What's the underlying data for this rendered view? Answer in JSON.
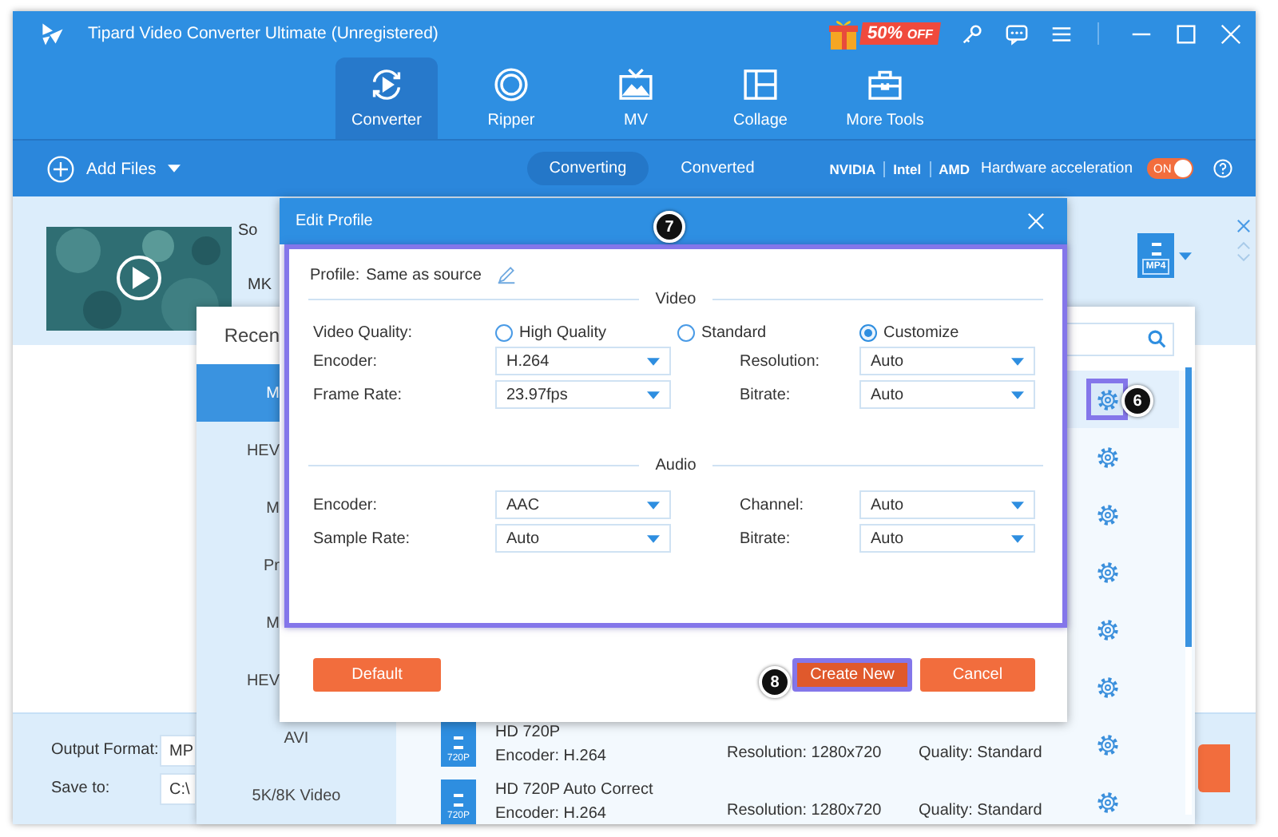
{
  "window": {
    "title": "Tipard Video Converter Ultimate (Unregistered)",
    "promo": {
      "percent": "50%",
      "suffix": "OFF"
    }
  },
  "nav_tabs": [
    {
      "label": "Converter",
      "selected": true,
      "kind": "converter"
    },
    {
      "label": "Ripper",
      "selected": false,
      "kind": "ripper"
    },
    {
      "label": "MV",
      "selected": false,
      "kind": "mv"
    },
    {
      "label": "Collage",
      "selected": false,
      "kind": "collage"
    },
    {
      "label": "More Tools",
      "selected": false,
      "kind": "tools"
    }
  ],
  "toolbar": {
    "add_files": "Add Files",
    "subtabs": [
      {
        "label": "Converting",
        "selected": true
      },
      {
        "label": "Converted",
        "selected": false
      }
    ],
    "vendors": [
      "NVIDIA",
      "Intel",
      "AMD"
    ],
    "hardware_label": "Hardware acceleration",
    "toggle": {
      "label": "ON",
      "on": true
    }
  },
  "file_item": {
    "source_label": "So",
    "format_label": "MK",
    "target_format": "MP4"
  },
  "output": {
    "format_label": "Output Format:",
    "format_value": "MP",
    "save_label": "Save to:",
    "save_value": "C:\\"
  },
  "format_panel": {
    "heading": "Recen",
    "categories": [
      {
        "label": "M",
        "selected": true
      },
      {
        "label": "HEV",
        "selected": false
      },
      {
        "label": "M",
        "selected": false
      },
      {
        "label": "Pr",
        "selected": false
      },
      {
        "label": "M",
        "selected": false
      },
      {
        "label": "HEV",
        "selected": false
      },
      {
        "label": "AVI",
        "selected": false
      },
      {
        "label": "5K/8K Video",
        "selected": false
      }
    ],
    "rows": [
      {
        "highlighted": true
      },
      {
        "highlighted": false
      },
      {
        "highlighted": false
      },
      {
        "highlighted": false
      },
      {
        "highlighted": false
      },
      {
        "highlighted": false
      },
      {
        "highlighted": false,
        "badge": "720P",
        "name": "HD 720P",
        "encoder": "Encoder: H.264",
        "resolution": "Resolution: 1280x720",
        "quality": "Quality: Standard"
      },
      {
        "highlighted": false,
        "badge": "720P",
        "name": "HD 720P Auto Correct",
        "encoder": "Encoder: H.264",
        "resolution": "Resolution: 1280x720",
        "quality": "Quality: Standard"
      }
    ]
  },
  "edit_profile": {
    "title": "Edit Profile",
    "profile_label": "Profile:",
    "profile_value": "Same as source",
    "video_heading": "Video",
    "quality_label": "Video Quality:",
    "quality_options": [
      {
        "label": "High Quality",
        "selected": false
      },
      {
        "label": "Standard",
        "selected": false
      },
      {
        "label": "Customize",
        "selected": true
      }
    ],
    "video_fields": [
      {
        "label": "Encoder:",
        "value": "H.264"
      },
      {
        "label": "Resolution:",
        "value": "Auto"
      },
      {
        "label": "Frame Rate:",
        "value": "23.97fps"
      },
      {
        "label": "Bitrate:",
        "value": "Auto"
      }
    ],
    "audio_heading": "Audio",
    "audio_fields": [
      {
        "label": "Encoder:",
        "value": "AAC"
      },
      {
        "label": "Channel:",
        "value": "Auto"
      },
      {
        "label": "Sample Rate:",
        "value": "Auto"
      },
      {
        "label": "Bitrate:",
        "value": "Auto"
      }
    ],
    "buttons": [
      {
        "label": "Default",
        "highlighted": false
      },
      {
        "label": "Create New",
        "highlighted": true
      },
      {
        "label": "Cancel",
        "highlighted": false
      }
    ]
  },
  "callouts": [
    "7",
    "6",
    "8"
  ]
}
